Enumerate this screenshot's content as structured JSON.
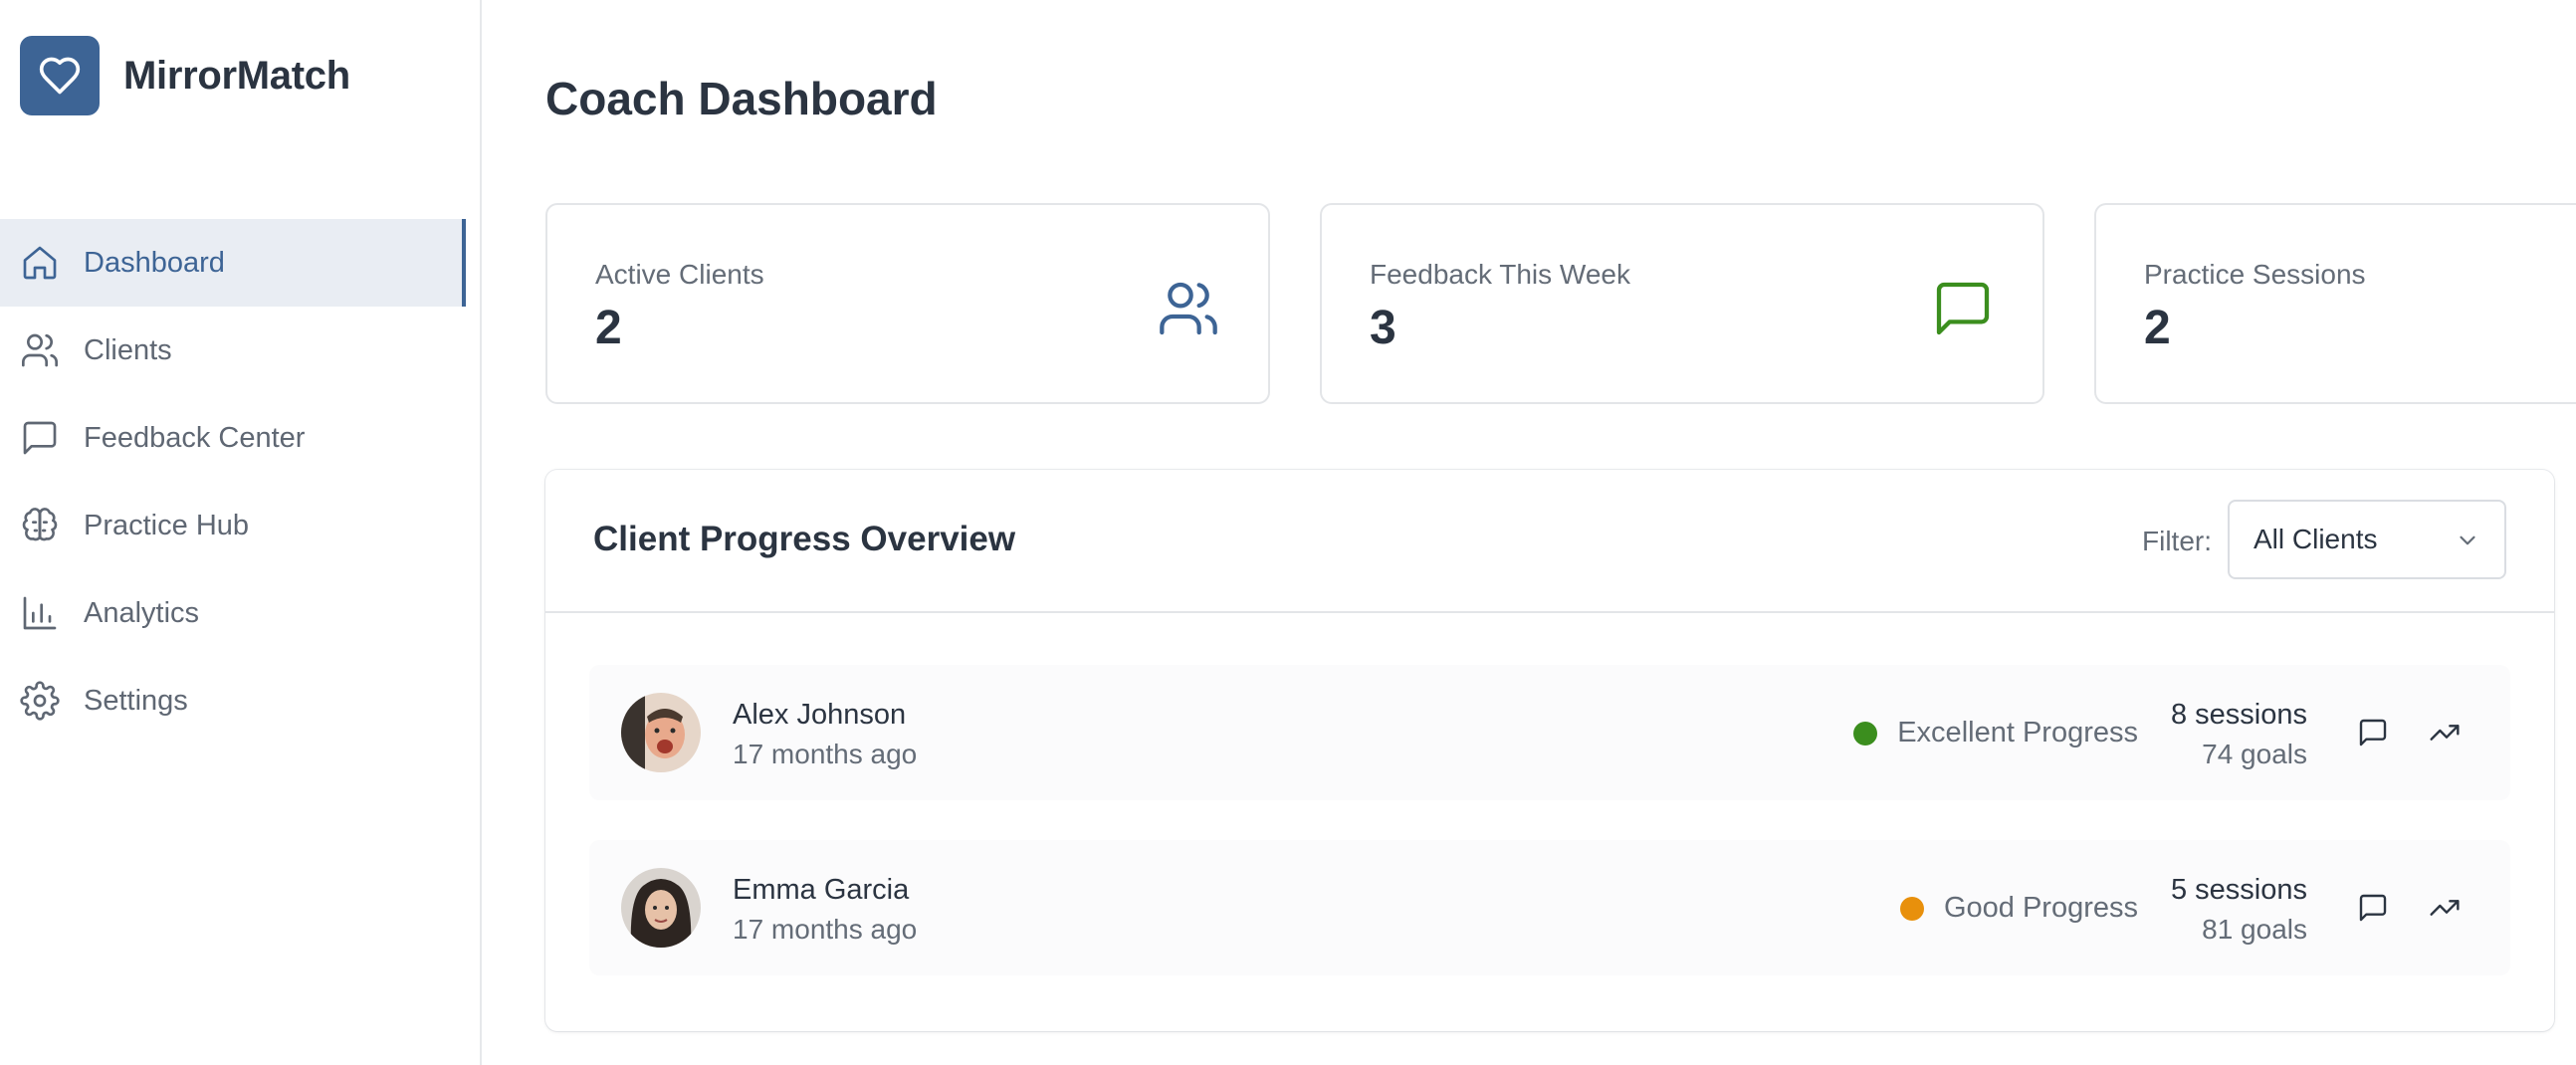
{
  "app": {
    "name": "MirrorMatch",
    "logo_icon": "heart-icon",
    "accent": "#3d6495"
  },
  "sidebar": {
    "items": [
      {
        "label": "Dashboard",
        "icon": "home-icon",
        "active": true
      },
      {
        "label": "Clients",
        "icon": "users-icon"
      },
      {
        "label": "Feedback Center",
        "icon": "message-square-icon"
      },
      {
        "label": "Practice Hub",
        "icon": "brain-icon"
      },
      {
        "label": "Analytics",
        "icon": "bar-chart-icon"
      },
      {
        "label": "Settings",
        "icon": "gear-icon"
      }
    ]
  },
  "page": {
    "title": "Coach Dashboard"
  },
  "stats": [
    {
      "label": "Active Clients",
      "value": "2",
      "icon": "users-icon",
      "color": "#3d6495"
    },
    {
      "label": "Feedback This Week",
      "value": "3",
      "icon": "message-square-icon",
      "color": "#3b8e1e"
    },
    {
      "label": "Practice Sessions",
      "value": "2"
    }
  ],
  "progress": {
    "title": "Client Progress Overview",
    "filter_label": "Filter:",
    "filter_value": "All Clients",
    "clients": [
      {
        "name": "Alex Johnson",
        "time": "17 months ago",
        "status": "Excellent Progress",
        "status_color": "#3b8e1e",
        "sessions": "8 sessions",
        "goals": "74 goals"
      },
      {
        "name": "Emma Garcia",
        "time": "17 months ago",
        "status": "Good Progress",
        "status_color": "#e8900c",
        "sessions": "5 sessions",
        "goals": "81 goals"
      }
    ]
  }
}
